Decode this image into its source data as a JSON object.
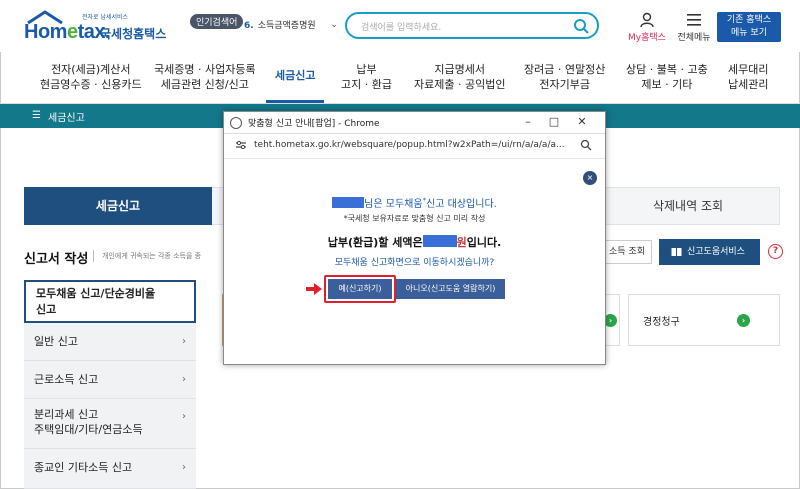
{
  "header": {
    "logo_text_a": "Hom",
    "logo_text_e": "e",
    "logo_text_b": "tax.",
    "logo_sub": "전자로 납세서비스",
    "logo_kr": "국세청홈택스",
    "popular_badge": "인기검색어",
    "popular_num": "6.",
    "popular_term": "소득금액증명원",
    "search_placeholder": "검색어를 입력하세요.",
    "my_hometax": "My홈택스",
    "all_menu": "전체메뉴",
    "old_hometax_line1": "기존 홈택스",
    "old_hometax_line2": "메뉴 보기"
  },
  "nav": [
    {
      "line1": "전자(세금)계산서",
      "line2": "현금영수증 · 신용카드"
    },
    {
      "line1": "국세증명 · 사업자등록",
      "line2": "세금관련 신청/신고"
    },
    {
      "line1": "세금신고",
      "line2": ""
    },
    {
      "line1": "납부",
      "line2": "고지 · 환급"
    },
    {
      "line1": "지급명세서",
      "line2": "자료제출 · 공익법인"
    },
    {
      "line1": "장려금 · 연말정산",
      "line2": "전자기부금"
    },
    {
      "line1": "상담 · 불복 · 고충",
      "line2": "제보 · 기타"
    },
    {
      "line1": "세무대리",
      "line2": "납세관리"
    }
  ],
  "breadcrumb": {
    "title": "세금신고"
  },
  "tabs": {
    "active": "세금신고",
    "right": "삭제내역 조회"
  },
  "section": {
    "title": "신고서 작성",
    "desc": "개인에게 귀속되는 각종 소득을 종",
    "inquiry_btn": "소득 조회",
    "help_btn": "신고도움서비스",
    "help_q": "?"
  },
  "left_menu": {
    "active_line1": "모두채움 신고/단순경비율",
    "active_line2": "신고",
    "items": [
      {
        "line1": "일반 신고",
        "line2": ""
      },
      {
        "line1": "근로소득 신고",
        "line2": ""
      },
      {
        "line1": "분리과세 신고",
        "line2": "주택임대/기타/연금소득"
      },
      {
        "line1": "종교인 기타소득 신고",
        "line2": ""
      }
    ]
  },
  "cards": {
    "claim_label": "경정청구"
  },
  "popup": {
    "window_title": "맞춤형 신고 안내[팝업] - Chrome",
    "url": "teht.hometax.go.kr/websquare/popup.html?w2xPath=/ui/rn/a/a/a/a...",
    "line1_suffix": "님은 모두채움",
    "line1_sup": "*",
    "line1_end": "신고 대상입니다.",
    "line2": "*국세청 보유자료로 맞춤형 신고 미리 작성",
    "line3_prefix": "납부(환급)할 세액은",
    "line3_won": "원",
    "line3_end": "입니다.",
    "line4": "모두채움 신고화면으로 이동하시겠습니까?",
    "yes_btn": "예(신고하기)",
    "no_btn": "아니오(신고도움 열람하기)",
    "close_symbol": "×"
  },
  "colors": {
    "brand": "#1a5aa8",
    "teal": "#13788a",
    "navy": "#1e4f7e",
    "highlight": "#e0202a"
  }
}
